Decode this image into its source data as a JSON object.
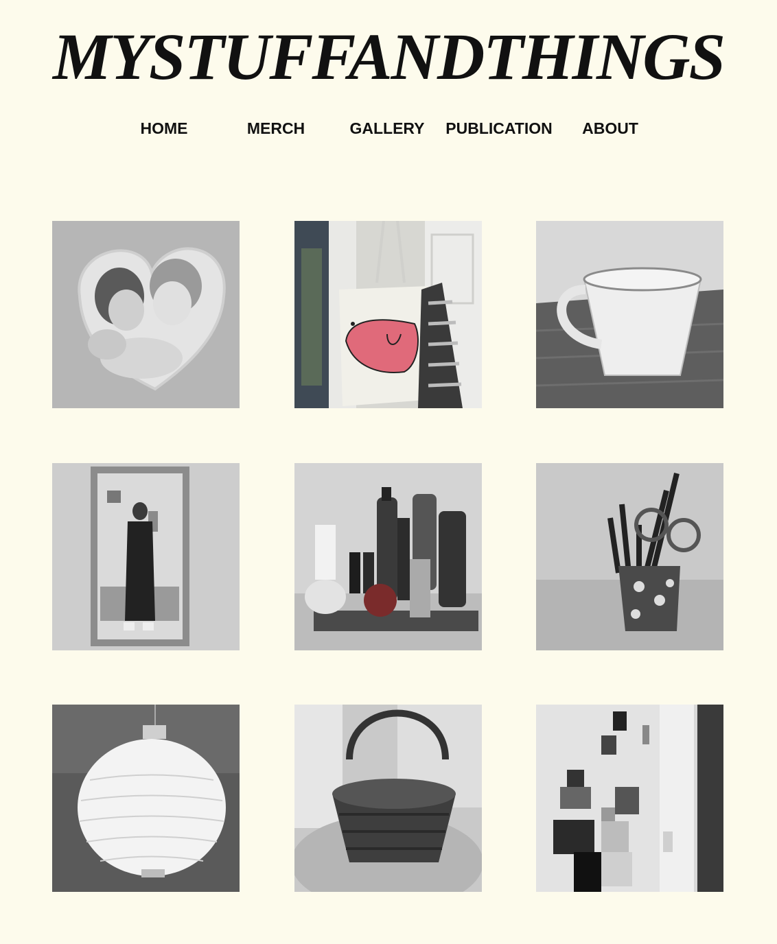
{
  "site": {
    "title": "MYSTUFFANDTHINGS"
  },
  "nav": {
    "items": [
      {
        "label": "HOME"
      },
      {
        "label": "MERCH"
      },
      {
        "label": "GALLERY"
      },
      {
        "label": "PUBLICATION"
      },
      {
        "label": "ABOUT"
      }
    ]
  },
  "gallery": {
    "photos": [
      {
        "subject": "heart-shaped box with two kissing cherubs",
        "style": "black-and-white"
      },
      {
        "subject": "tote bag with pink face drawing hanging on door",
        "style": "black-and-white with pink"
      },
      {
        "subject": "white cup on wooden table",
        "style": "black-and-white"
      },
      {
        "subject": "mirror selfie in hallway",
        "style": "black-and-white"
      },
      {
        "subject": "oil bottles and salt on tray",
        "style": "black-and-white with red"
      },
      {
        "subject": "pen and scissors holder",
        "style": "black-and-white"
      },
      {
        "subject": "round paper lantern lamp",
        "style": "black-and-white"
      },
      {
        "subject": "wicker basket on table",
        "style": "black-and-white"
      },
      {
        "subject": "postcards and magnets on fridge door",
        "style": "black-and-white"
      }
    ]
  },
  "colors": {
    "background": "#fdfbec",
    "text": "#111111",
    "accent_pink": "#e06a7a"
  }
}
